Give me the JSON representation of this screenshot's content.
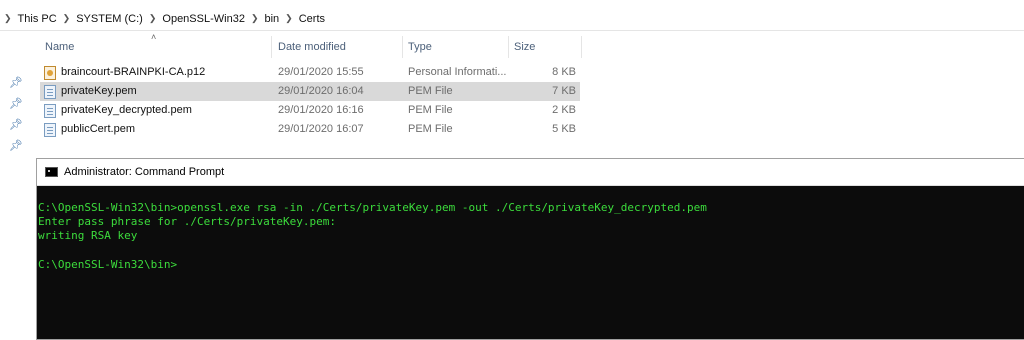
{
  "breadcrumb": [
    "This PC",
    "SYSTEM (C:)",
    "OpenSSL-Win32",
    "bin",
    "Certs"
  ],
  "columns": {
    "name": "Name",
    "date": "Date modified",
    "type": "Type",
    "size": "Size"
  },
  "files": [
    {
      "name": "braincourt-BRAINPKI-CA.p12",
      "date": "29/01/2020 15:55",
      "type": "Personal Informati...",
      "size": "8 KB",
      "icon": "certificate-file-icon",
      "selected": false
    },
    {
      "name": "privateKey.pem",
      "date": "29/01/2020 16:04",
      "type": "PEM File",
      "size": "7 KB",
      "icon": "pem-file-icon",
      "selected": true
    },
    {
      "name": "privateKey_decrypted.pem",
      "date": "29/01/2020 16:16",
      "type": "PEM File",
      "size": "2 KB",
      "icon": "pem-file-icon",
      "selected": false
    },
    {
      "name": "publicCert.pem",
      "date": "29/01/2020 16:07",
      "type": "PEM File",
      "size": "5 KB",
      "icon": "pem-file-icon",
      "selected": false
    }
  ],
  "cmd": {
    "title": "Administrator: Command Prompt",
    "lines": [
      "C:\\OpenSSL-Win32\\bin>openssl.exe rsa -in ./Certs/privateKey.pem -out ./Certs/privateKey_decrypted.pem",
      "Enter pass phrase for ./Certs/privateKey.pem:",
      "writing RSA key",
      "",
      "C:\\OpenSSL-Win32\\bin>"
    ]
  },
  "colors": {
    "console_bg": "#0c0c0c",
    "console_text": "#3cdc3c",
    "selection": "#d9d9d9"
  }
}
